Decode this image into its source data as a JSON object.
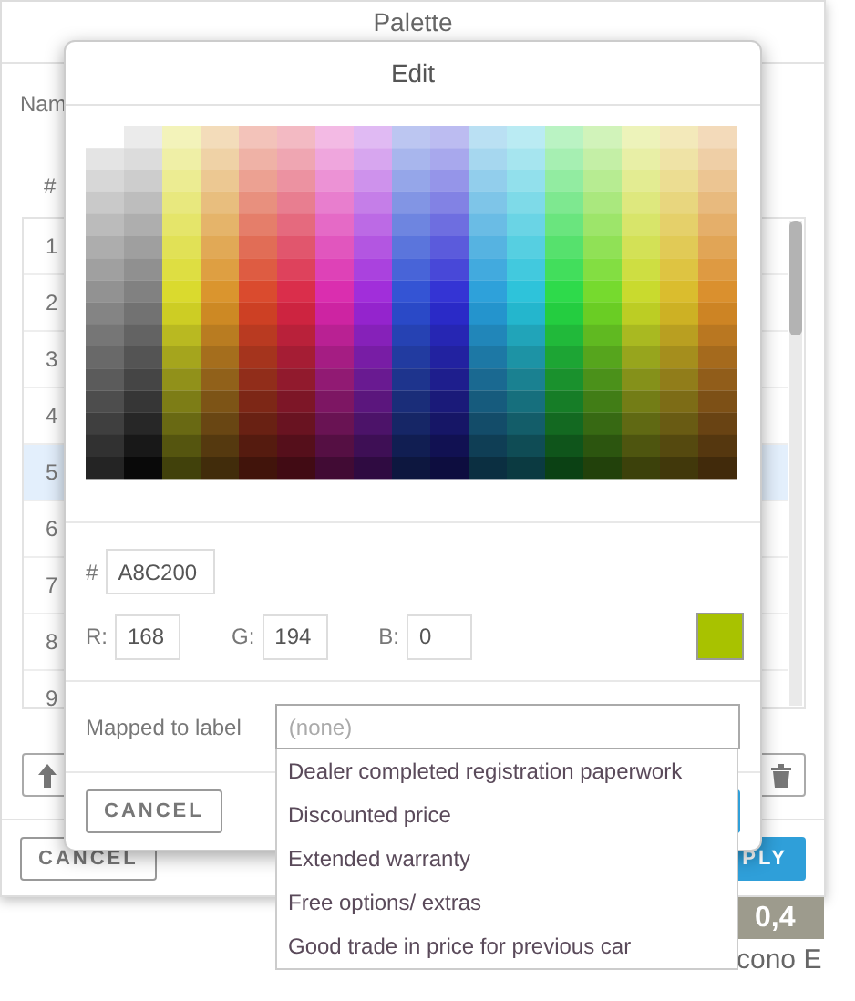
{
  "palette_dialog": {
    "title": "Palette",
    "name_label": "Nam",
    "table": {
      "column": "#",
      "rows": [
        {
          "number": "1",
          "selected": false
        },
        {
          "number": "2",
          "selected": false
        },
        {
          "number": "3",
          "selected": false
        },
        {
          "number": "4",
          "selected": false
        },
        {
          "number": "5",
          "selected": true
        },
        {
          "number": "6",
          "selected": false
        },
        {
          "number": "7",
          "selected": false
        },
        {
          "number": "8",
          "selected": false
        },
        {
          "number": "9",
          "selected": false
        }
      ]
    },
    "cancel_button": "CANCEL",
    "apply_button": "PLY"
  },
  "background": {
    "tile_text": "0,4",
    "caption": "cono E"
  },
  "edit_dialog": {
    "title": "Edit",
    "hex_label": "#",
    "hex_value": "A8C200",
    "channels": [
      {
        "label": "R:",
        "value": "168"
      },
      {
        "label": "G:",
        "value": "194"
      },
      {
        "label": "B:",
        "value": "0"
      }
    ],
    "swatch": {
      "color": "#a8c200"
    },
    "mapped_label": "Mapped to label",
    "mapped_placeholder": "(none)",
    "options": [
      "Dealer completed registration paperwork",
      "Discounted price",
      "Extended warranty",
      "Free options/ extras",
      "Good trade in price for previous car"
    ],
    "cancel_button": "CANCEL"
  }
}
